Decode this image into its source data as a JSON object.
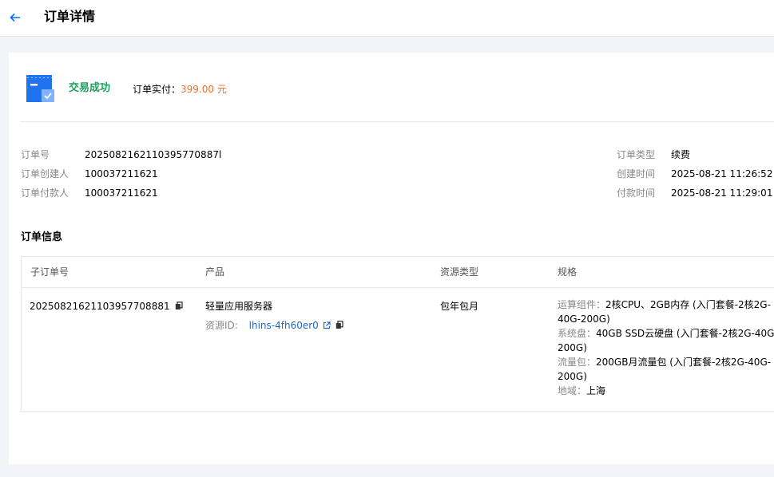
{
  "header": {
    "title": "订单详情"
  },
  "status": {
    "text": "交易成功",
    "paid_label": "订单实付：",
    "paid_amount": "399.00 元"
  },
  "info_left": [
    {
      "key": "订单号",
      "value": "2025082162110395770887l"
    },
    {
      "key": "订单创建人",
      "value": "100037211621"
    },
    {
      "key": "订单付款人",
      "value": "100037211621"
    }
  ],
  "info_right": [
    {
      "key": "订单类型",
      "value": "续费"
    },
    {
      "key": "创建时间",
      "value": "2025-08-21 11:26:52"
    },
    {
      "key": "付款时间",
      "value": "2025-08-21 11:29:01"
    }
  ],
  "section": {
    "title": "订单信息"
  },
  "table": {
    "headers": [
      "子订单号",
      "产品",
      "资源类型",
      "规格"
    ],
    "row": {
      "sub_order_no": "20250821621103957708881",
      "product": "轻量应用服务器",
      "resource_id_label": "资源ID:",
      "resource_id": "lhins-4fh60er0",
      "resource_type": "包年包月",
      "specs": [
        {
          "key": "运算组件：",
          "value": "2核CPU、2GB内存 (入门套餐-2核2G-40G-200G)"
        },
        {
          "key": "系统盘：",
          "value": "40GB SSD云硬盘 (入门套餐-2核2G-40G-200G)"
        },
        {
          "key": "流量包：",
          "value": "200GB月流量包 (入门套餐-2核2G-40G-200G)"
        },
        {
          "key": "地域：",
          "value": "上海"
        }
      ]
    }
  }
}
